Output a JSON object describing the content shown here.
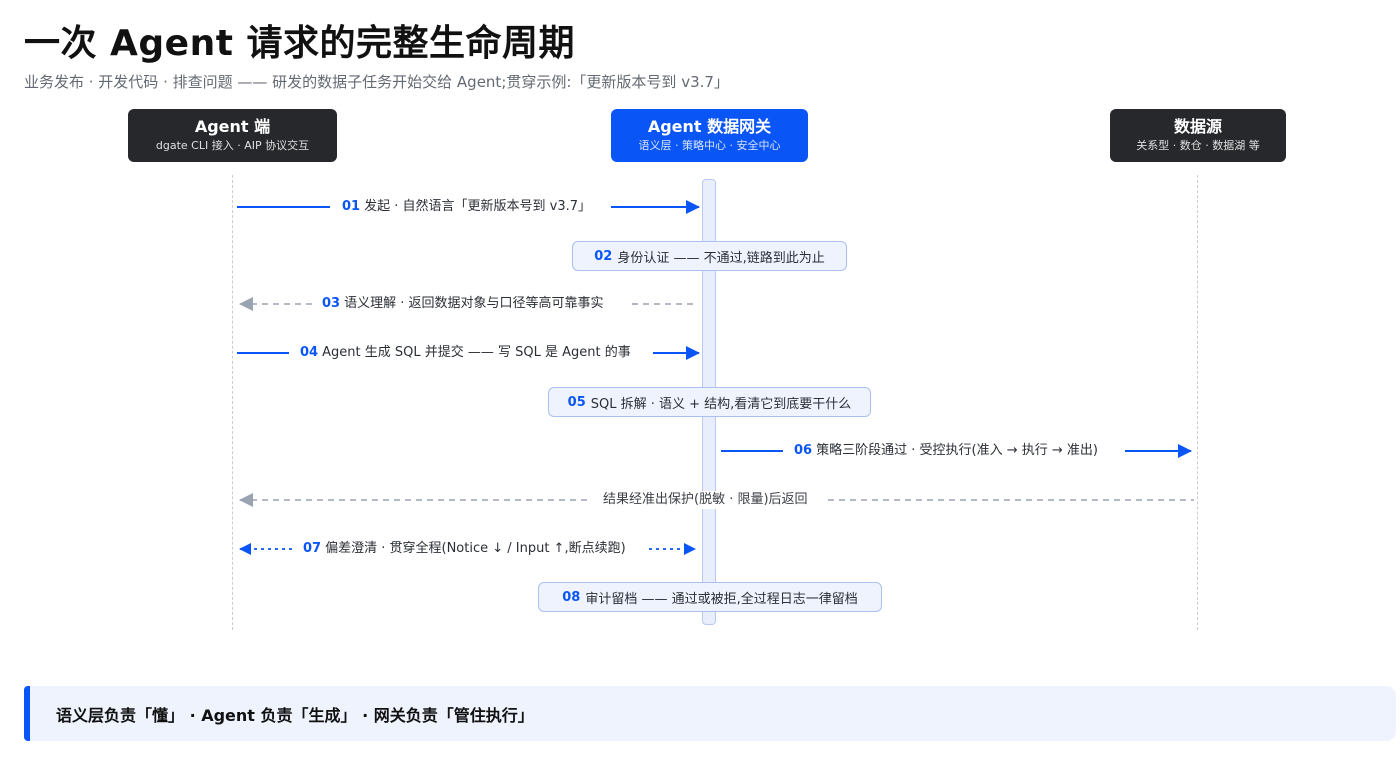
{
  "header": {
    "title": "一次 Agent 请求的完整生命周期",
    "subtitle": "业务发布 · 开发代码 · 排查问题 —— 研发的数据子任务开始交给 Agent;贯穿示例:「更新版本号到 v3.7」"
  },
  "actors": [
    {
      "name": "Agent 端",
      "desc": "dgate CLI 接入 · AIP 协议交互"
    },
    {
      "name": "Agent 数据网关",
      "desc": "语义层 · 策略中心 · 安全中心"
    },
    {
      "name": "数据源",
      "desc": "关系型 · 数仓 · 数据湖 等"
    }
  ],
  "steps": {
    "s01": {
      "num": "01",
      "text": "发起 · 自然语言「更新版本号到 v3.7」"
    },
    "s02": {
      "num": "02",
      "text": "身份认证 —— 不通过,链路到此为止"
    },
    "s03": {
      "num": "03",
      "text": "语义理解 · 返回数据对象与口径等高可靠事实"
    },
    "s04": {
      "num": "04",
      "text": "Agent 生成 SQL 并提交 —— 写 SQL 是 Agent 的事"
    },
    "s05": {
      "num": "05",
      "text": "SQL 拆解 · 语义 + 结构,看清它到底要干什么"
    },
    "s06": {
      "num": "06",
      "text": "策略三阶段通过 · 受控执行(准入 → 执行 → 准出)"
    },
    "ret": {
      "text": "结果经准出保护(脱敏 · 限量)后返回"
    },
    "s07": {
      "num": "07",
      "text": "偏差澄清 · 贯穿全程(Notice ↓ / Input ↑,断点续跑)"
    },
    "s08": {
      "num": "08",
      "text": "审计留档 —— 通过或被拒,全过程日志一律留档"
    }
  },
  "summary": {
    "text": "语义层负责「懂」 · Agent 负责「生成」 · 网关负责「管住执行」"
  },
  "colors": {
    "accent": "#0a55f6",
    "dark": "#26282b",
    "return_arrow": "#9aa3b0",
    "panel": "#eef3fe"
  }
}
